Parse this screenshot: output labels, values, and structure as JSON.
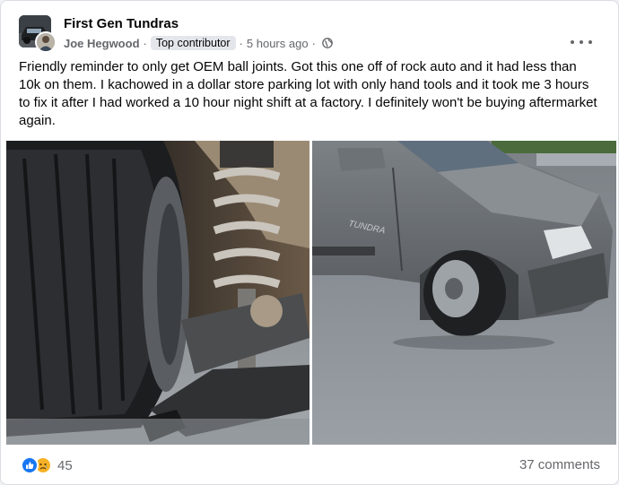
{
  "post": {
    "group_name": "First Gen Tundras",
    "author": "Joe Hegwood",
    "badge": "Top contributor",
    "time": "5 hours ago",
    "privacy_icon": "globe-icon",
    "more_icon": "more-options-icon",
    "text": "Friendly reminder to only get OEM ball joints. Got this one off of rock auto and it had less than 10k on them. I kachowed in a dollar store parking lot with only hand tools and it took me 3 hours to fix it after I had worked a 10 hour night shift at a factory. I definitely won't be buying aftermarket again."
  },
  "photos": [
    {
      "name": "broken-ball-joint-photo"
    },
    {
      "name": "tundra-truck-photo"
    }
  ],
  "reactions": {
    "icons": [
      "like-icon",
      "sad-icon"
    ],
    "count": "45"
  },
  "comments": "37 comments",
  "colors": {
    "like": "#1877f2",
    "sad": "#f7b125",
    "text": "#050505",
    "muted": "#65676b"
  }
}
